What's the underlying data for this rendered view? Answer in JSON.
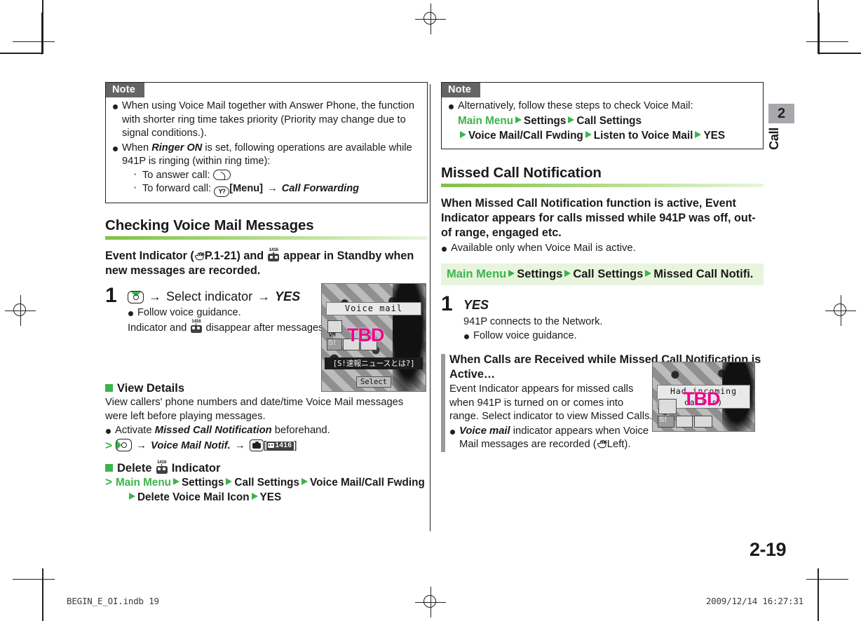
{
  "document": {
    "page_number": "2-19",
    "chapter_tab_number": "2",
    "chapter_tab_label": "Call",
    "footer_left": "BEGIN_E_OI.indb    19",
    "footer_right": "2009/12/14      16:27:31"
  },
  "left_column": {
    "note": {
      "label": "Note",
      "items": [
        "When using Voice Mail together with Answer Phone, the function with shorter ring time takes priority (Priority may change due to signal conditions.).",
        "When Ringer ON is set, following operations are available while 941P is ringing (within ring time):"
      ],
      "item2_pre": "When ",
      "item2_em": "Ringer ON",
      "item2_post": " is set, following operations are available while 941P is ringing (within ring time):",
      "sub_items": [
        {
          "label": "To answer call:",
          "icon": "send-key-icon"
        },
        {
          "label": "To forward call:",
          "icon": "y-key-icon",
          "bracket": "[Menu]",
          "arrow": "→",
          "target": "Call Forwarding"
        }
      ]
    },
    "heading": "Checking Voice Mail Messages",
    "lead_pre": "Event Indicator (",
    "lead_ref": "P.1-21",
    "lead_mid": ") and ",
    "lead_post": " appear in Standby when new messages are recorded.",
    "step": {
      "number": "1",
      "head_mid": "Select indicator",
      "head_end": "YES",
      "arrow": "→",
      "bullet": "Follow voice guidance.",
      "body_pre": "Indicator and ",
      "body_post": " disappear after messages are checked."
    },
    "view_details": {
      "heading": "View Details",
      "para": "View callers' phone numbers and date/time Voice Mail messages were left before playing messages.",
      "bullet_pre": "Activate ",
      "bullet_em": "Missed Call Notification",
      "bullet_post": " beforehand.",
      "path_item": "Voice Mail Notif.",
      "tag_value": "1416"
    },
    "delete_section": {
      "heading_pre": "Delete",
      "heading_post": "Indicator",
      "path": [
        "Main Menu",
        "Settings",
        "Call Settings",
        "Voice Mail/Call Fwding",
        "Delete Voice Mail Icon",
        "YES"
      ]
    },
    "screenshot": {
      "title": "Voice mail",
      "tbd": "TBD",
      "ticker": "[S!速報ニュースとは?]",
      "softkey": "Select",
      "vm_label": "VM",
      "s1_label": "S!"
    }
  },
  "right_column": {
    "note": {
      "label": "Note",
      "bullet": "Alternatively, follow these steps to check Voice Mail:",
      "path_line1": [
        "Main Menu",
        "Settings",
        "Call Settings"
      ],
      "path_line2": [
        "Voice Mail/Call Fwding",
        "Listen to Voice Mail",
        "YES"
      ]
    },
    "heading": "Missed Call Notification",
    "lead": "When Missed Call Notification function is active, Event Indicator appears for calls missed while 941P was off, out-of range, engaged etc.",
    "bullet": "Available only when Voice Mail is active.",
    "menu_bar": [
      "Main Menu",
      "Settings",
      "Call Settings",
      "Missed Call Notifi."
    ],
    "step": {
      "number": "1",
      "head": "YES",
      "body": "941P connects to the Network.",
      "bullet": "Follow voice guidance."
    },
    "sidebar_block": {
      "title": "When Calls are Received while Missed Call Notification is Active…",
      "para": "Event Indicator appears for missed calls when 941P is turned on or comes into range. Select indicator to view Missed Calls.",
      "bullet_em": "Voice mail",
      "bullet_rest": " indicator appears when Voice Mail messages are recorded (",
      "bullet_ref": "Left",
      "bullet_end": ")."
    },
    "screenshot": {
      "title": "Had incoming call(s)",
      "tbd": "TBD",
      "s1_label": "S!"
    }
  },
  "colors": {
    "accent_green": "#3cb44a",
    "menu_bar_bg": "#e8f5dd",
    "note_label_bg": "#636466",
    "tab_bg": "#a6a8ab",
    "tbd_pink": "#ec008c"
  }
}
